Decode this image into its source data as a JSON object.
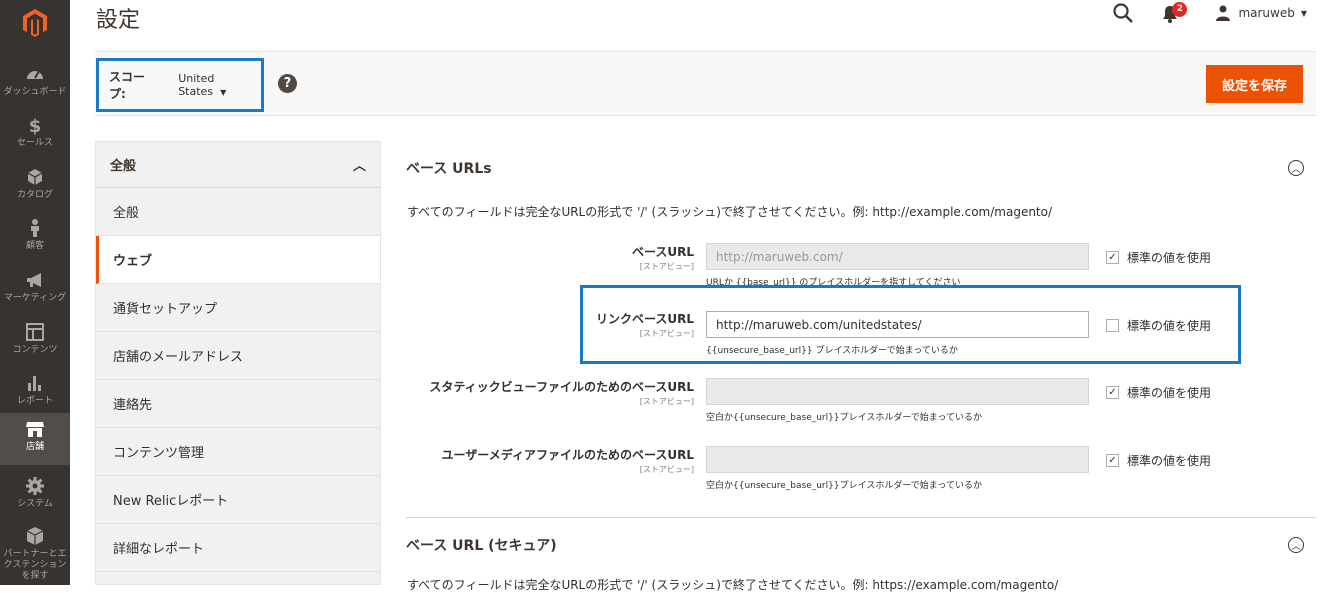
{
  "sidebar": {
    "items": [
      {
        "label": "ダッシュボード",
        "icon": "dashboard-icon"
      },
      {
        "label": "セールス",
        "icon": "dollar-icon"
      },
      {
        "label": "カタログ",
        "icon": "box-icon"
      },
      {
        "label": "顧客",
        "icon": "person-icon"
      },
      {
        "label": "マーケティング",
        "icon": "megaphone-icon"
      },
      {
        "label": "コンテンツ",
        "icon": "layout-icon"
      },
      {
        "label": "レポート",
        "icon": "bar-chart-icon"
      },
      {
        "label": "店舗",
        "icon": "store-icon"
      },
      {
        "label": "システム",
        "icon": "gear-icon"
      },
      {
        "label": "パートナーとエクステンションを探す",
        "icon": "cube-icon"
      }
    ]
  },
  "header": {
    "title": "設定",
    "notification_count": "2",
    "username": "maruweb"
  },
  "scope": {
    "label": "スコープ:",
    "value": "United States",
    "help": "?"
  },
  "toolbar": {
    "save_label": "設定を保存"
  },
  "tabs": {
    "title": "全般",
    "items": [
      "全般",
      "ウェブ",
      "通貨セットアップ",
      "店舗のメールアドレス",
      "連絡先",
      "コンテンツ管理",
      "New Relicレポート",
      "詳細なレポート"
    ]
  },
  "base_urls": {
    "title": "ベース URLs",
    "description": "すべてのフィールドは完全なURLの形式で '/' (スラッシュ)で終了させてください。例: http://example.com/magento/",
    "scope_label": "[ストアビュー]",
    "use_default_label": "標準の値を使用",
    "rows": [
      {
        "label": "ベースURL",
        "value": "http://maruweb.com/",
        "note": "URLか {{base_url}} のプレイスホルダーを指すしてください",
        "use_default": true
      },
      {
        "label": "リンクベースURL",
        "value": "http://maruweb.com/unitedstates/",
        "note": "{{unsecure_base_url}} プレイスホルダーで始まっているか",
        "use_default": false
      },
      {
        "label": "スタティックビューファイルのためのベースURL",
        "value": "",
        "note": "空白か{{unsecure_base_url}}プレイスホルダーで始まっているか",
        "use_default": true
      },
      {
        "label": "ユーザーメディアファイルのためのベースURL",
        "value": "",
        "note": "空白か{{unsecure_base_url}}プレイスホルダーで始まっているか",
        "use_default": true
      }
    ]
  },
  "base_urls_secure": {
    "title": "ベース URL (セキュア)",
    "description": "すべてのフィールドは完全なURLの形式で '/' (スラッシュ)で終了させてください。例: https://example.com/magento/"
  },
  "colors": {
    "accent": "#eb5202",
    "sidebar": "#373330",
    "highlight": "#1979c3"
  }
}
